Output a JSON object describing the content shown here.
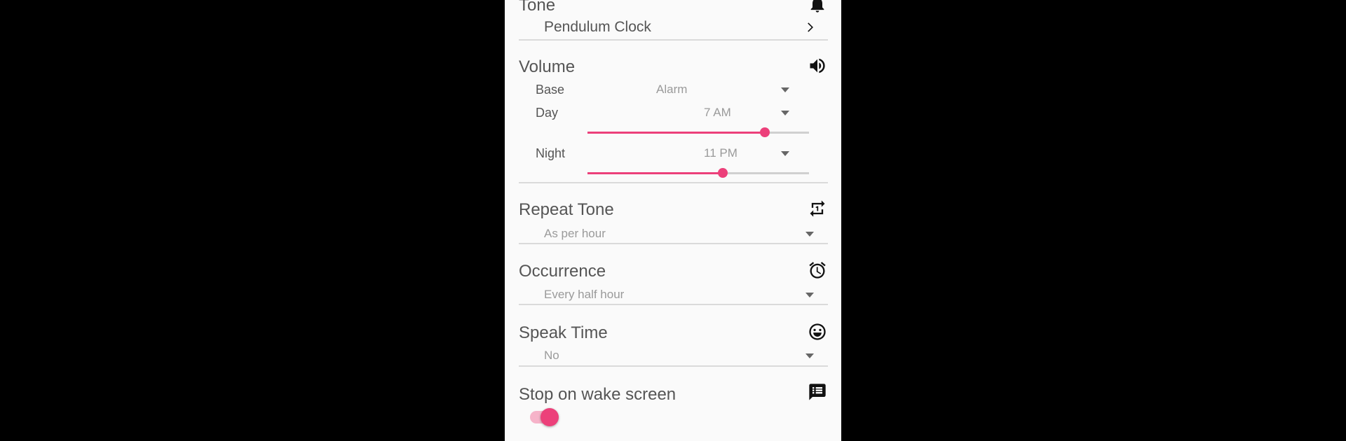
{
  "tone": {
    "title": "Tone",
    "value": "Pendulum Clock"
  },
  "volume": {
    "title": "Volume",
    "base": {
      "label": "Base",
      "value": "Alarm"
    },
    "day": {
      "label": "Day",
      "value": "7 AM",
      "level": 0.8
    },
    "night": {
      "label": "Night",
      "value": "11 PM",
      "level": 0.61
    }
  },
  "repeat_tone": {
    "title": "Repeat Tone",
    "value": "As per hour"
  },
  "occurrence": {
    "title": "Occurrence",
    "value": "Every half hour"
  },
  "speak_time": {
    "title": "Speak Time",
    "value": "No"
  },
  "stop_on_wake": {
    "title": "Stop on wake screen",
    "enabled": true
  },
  "colors": {
    "accent": "#ec407a",
    "track": "#d0d0d0"
  }
}
